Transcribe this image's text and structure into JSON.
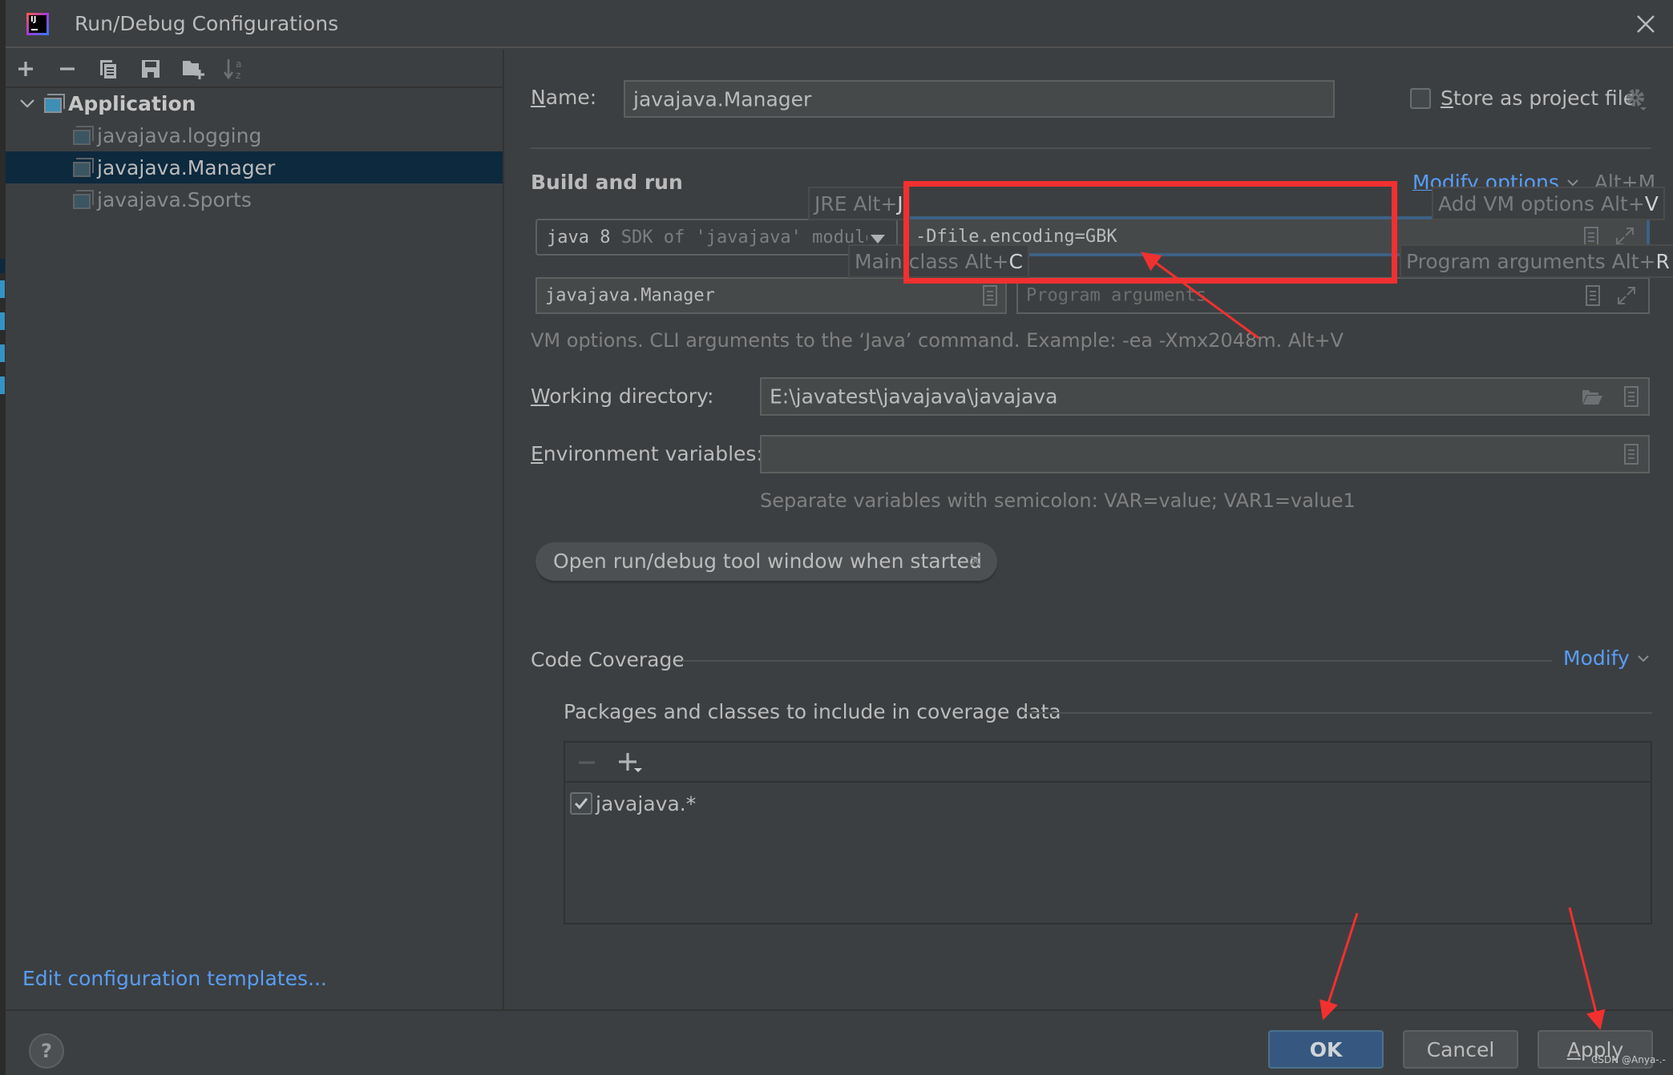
{
  "window": {
    "title": "Run/Debug Configurations",
    "app_icon": "intellij-idea-icon",
    "close_icon": "close-icon"
  },
  "sidebar": {
    "toolbar": [
      {
        "name": "add-configuration-button",
        "icon": "plus-icon"
      },
      {
        "name": "remove-configuration-button",
        "icon": "minus-icon"
      },
      {
        "name": "copy-configuration-button",
        "icon": "copy-icon"
      },
      {
        "name": "save-configuration-button",
        "icon": "save-icon"
      },
      {
        "name": "move-to-folder-button",
        "icon": "new-folder-icon"
      },
      {
        "name": "sort-configurations-button",
        "icon": "sort-alpha-icon"
      }
    ],
    "tree": {
      "group": "Application",
      "items": [
        {
          "label": "javajava.logging",
          "selected": false
        },
        {
          "label": "javajava.Manager",
          "selected": true
        },
        {
          "label": "javajava.Sports",
          "selected": false
        }
      ]
    },
    "edit_templates_link": "Edit configuration templates..."
  },
  "main": {
    "name_label": "Name:",
    "name_mnemonic": "N",
    "name_value": "javajava.Manager",
    "store_as_project_file": {
      "label": "Store as project file",
      "mnemonic": "S",
      "checked": false
    },
    "build_and_run": {
      "title": "Build and run",
      "modify_options_link": "Modify options",
      "modify_options_shortcut": "Alt+M",
      "jre": {
        "version": "java 8",
        "detail": "SDK of 'javajava' module"
      },
      "vm_options_value": "-Dfile.encoding=GBK",
      "main_class_value": "javajava.Manager",
      "program_arguments_placeholder": "Program arguments",
      "hint": "VM options. CLI arguments to the ‘Java’ command. Example: -ea -Xmx2048m. Alt+V",
      "tooltips": {
        "jre": {
          "text": "JRE Alt+",
          "key": "J"
        },
        "add_vm": {
          "text": "Add VM options Alt+",
          "key": "V"
        },
        "main_class": {
          "text": "Main class Alt+",
          "key": "C"
        },
        "program_args": {
          "text": "Program arguments Alt+",
          "key": "R"
        }
      }
    },
    "working_directory": {
      "label": "Working directory:",
      "mnemonic": "W",
      "value": "E:\\javatest\\javajava\\javajava"
    },
    "environment_variables": {
      "label": "Environment variables:",
      "mnemonic": "E",
      "value": "",
      "hint": "Separate variables with semicolon: VAR=value; VAR1=value1"
    },
    "option_chip": "Open run/debug tool window when started",
    "code_coverage": {
      "title": "Code Coverage",
      "modify_link": "Modify",
      "packages_label": "Packages and classes to include in coverage data",
      "entries": [
        {
          "pattern": "javajava.*",
          "checked": true
        }
      ]
    }
  },
  "footer": {
    "help_label": "?",
    "ok_label": "OK",
    "cancel_label": "Cancel",
    "apply_label": "Apply",
    "apply_mnemonic": "A"
  },
  "watermark": "CSDN @Anya-.-",
  "colors": {
    "background": "#3c3f41",
    "selection": "#0d293e",
    "link": "#589df6",
    "primary_button": "#365880",
    "focus_ring": "#3d6185",
    "annotation_red": "#f23030"
  }
}
